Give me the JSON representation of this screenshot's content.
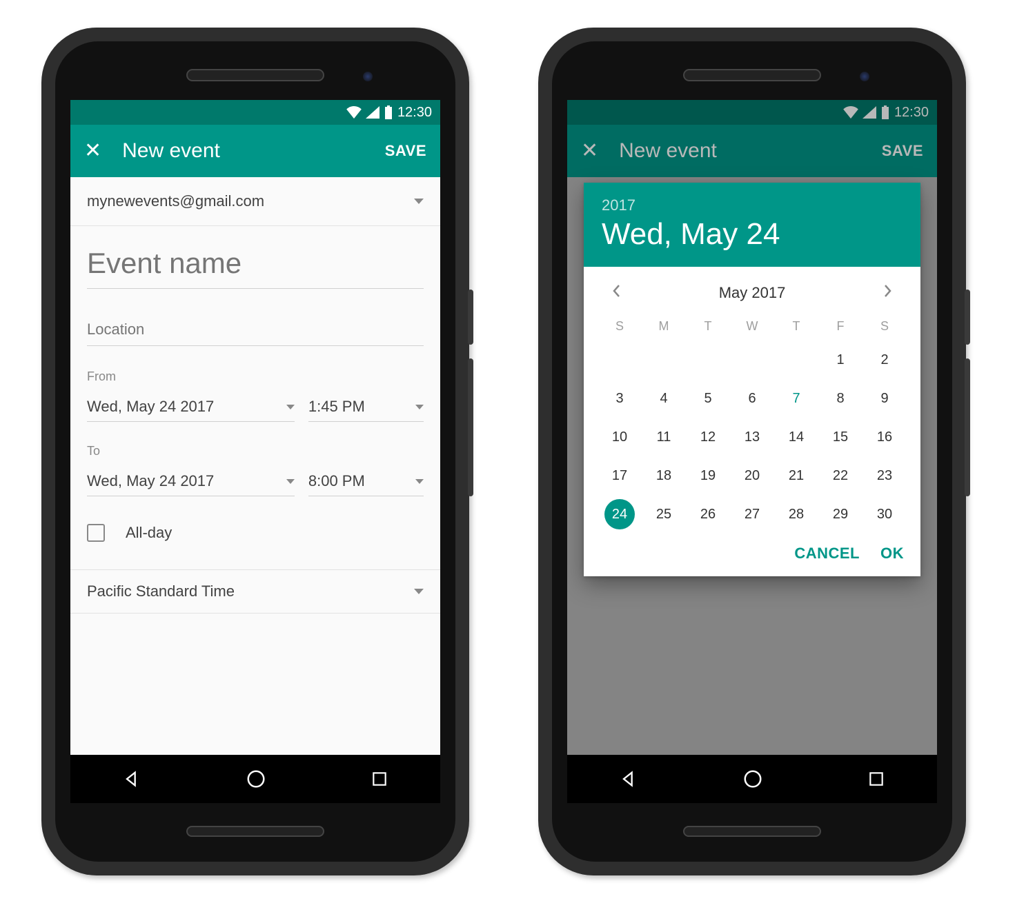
{
  "status": {
    "time": "12:30"
  },
  "appbar": {
    "title": "New event",
    "save": "SAVE"
  },
  "account": {
    "email": "mynewevents@gmail.com"
  },
  "event": {
    "name_placeholder": "Event name",
    "location_placeholder": "Location",
    "from_label": "From",
    "to_label": "To",
    "from_date": "Wed, May 24 2017",
    "from_time": "1:45 PM",
    "to_date": "Wed, May 24 2017",
    "to_time": "8:00 PM",
    "allday_label": "All-day",
    "timezone": "Pacific Standard Time"
  },
  "datepicker": {
    "year": "2017",
    "header_date": "Wed, May 24",
    "month_title": "May 2017",
    "dow": [
      "S",
      "M",
      "T",
      "W",
      "T",
      "F",
      "S"
    ],
    "lead_blanks": 5,
    "days_in_month": 30,
    "selected_day": 24,
    "highlight_day": 7,
    "cancel": "CANCEL",
    "ok": "OK"
  }
}
